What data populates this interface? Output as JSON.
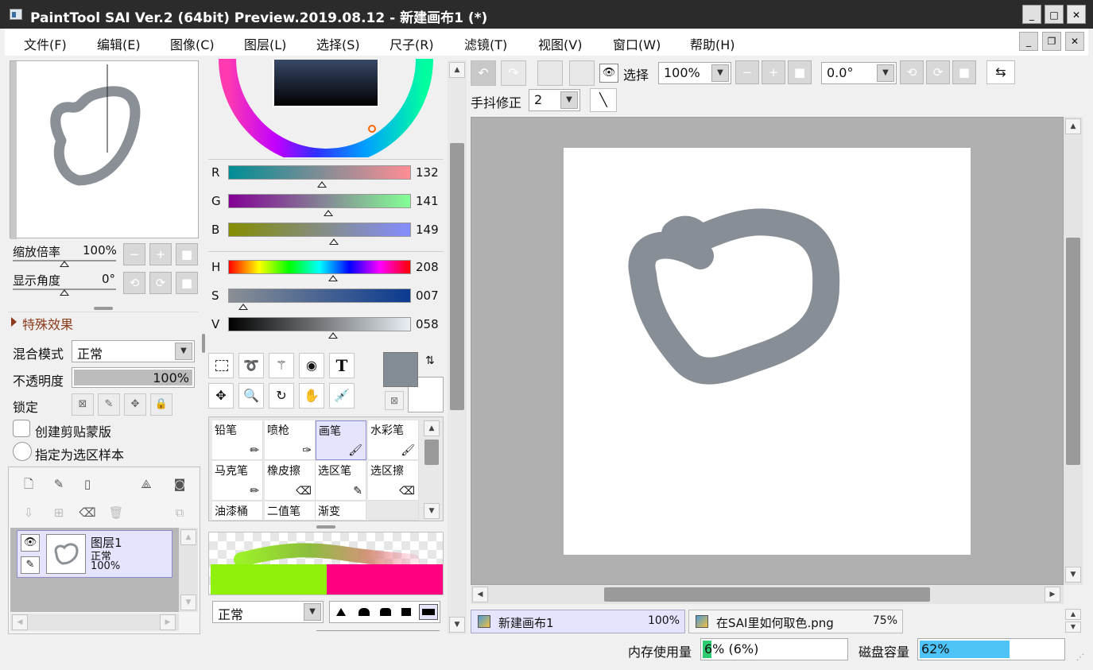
{
  "window": {
    "title": "PaintTool SAI Ver.2 (64bit) Preview.2019.08.12 - 新建画布1 (*)"
  },
  "menu": [
    "文件(F)",
    "编辑(E)",
    "图像(C)",
    "图层(L)",
    "选择(S)",
    "尺子(R)",
    "滤镜(T)",
    "视图(V)",
    "窗口(W)",
    "帮助(H)"
  ],
  "navigator": {
    "zoom_label": "缩放倍率",
    "zoom_value": "100%",
    "angle_label": "显示角度",
    "angle_value": "0°"
  },
  "effects": {
    "label": "特殊效果"
  },
  "layer_props": {
    "blend_label": "混合模式",
    "blend_value": "正常",
    "opacity_label": "不透明度",
    "opacity_value": "100%",
    "lock_label": "锁定",
    "clip_label": "创建剪贴蒙版",
    "selsrc_label": "指定为选区样本"
  },
  "layers": [
    {
      "name": "图层1",
      "mode": "正常",
      "opacity": "100%"
    }
  ],
  "color": {
    "current_hex": "#848d95",
    "sliders": [
      {
        "label": "R",
        "value": "132",
        "pos": 0.515
      },
      {
        "label": "G",
        "value": "141",
        "pos": 0.553
      },
      {
        "label": "B",
        "value": "149",
        "pos": 0.584
      },
      {
        "label": "H",
        "value": "208",
        "pos": 0.578
      },
      {
        "label": "S",
        "value": "007",
        "pos": 0.07
      },
      {
        "label": "V",
        "value": "058",
        "pos": 0.578
      }
    ]
  },
  "tools": {
    "text_tool": "T"
  },
  "brushes": [
    {
      "name": "铅笔"
    },
    {
      "name": "喷枪"
    },
    {
      "name": "画笔",
      "selected": true
    },
    {
      "name": "水彩笔"
    },
    {
      "name": "马克笔"
    },
    {
      "name": "橡皮擦"
    },
    {
      "name": "选区笔"
    },
    {
      "name": "选区擦"
    },
    {
      "name": "油漆桶"
    },
    {
      "name": "二值笔"
    },
    {
      "name": "渐变"
    },
    {
      "name": ""
    }
  ],
  "brush_mode": "正常",
  "canvas_toolbar": {
    "select_label": "选择",
    "zoom_value": "100%",
    "angle_value": "0.0°",
    "stabilizer_label": "手抖修正",
    "stabilizer_value": "2"
  },
  "tabs": [
    {
      "name": "新建画布1",
      "zoom": "100%"
    },
    {
      "name": "在SAI里如何取色.png",
      "zoom": "75%"
    }
  ],
  "status": {
    "memory_label": "内存使用量",
    "memory_value": "6% (6%)",
    "memory_pct": 6,
    "disk_label": "磁盘容量",
    "disk_value": "62%",
    "disk_pct": 62
  }
}
